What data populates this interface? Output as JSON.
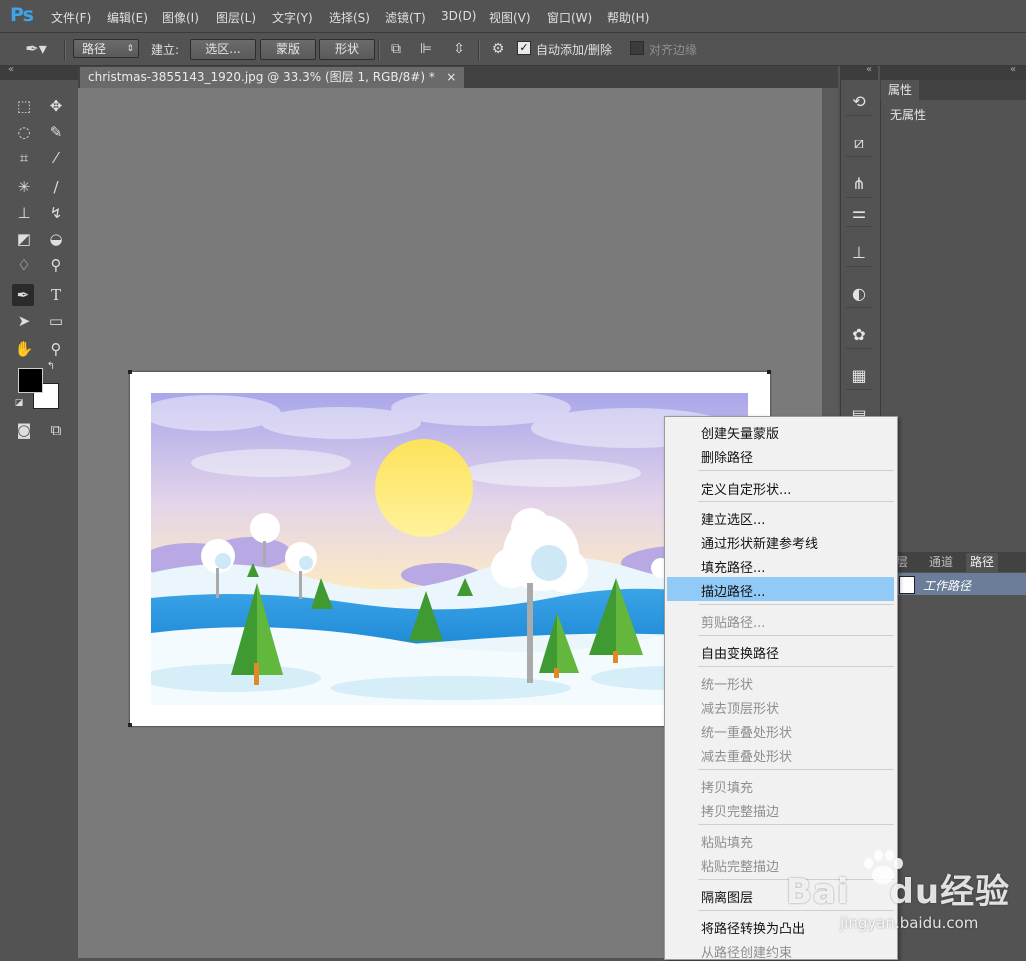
{
  "app": {
    "logo": "Ps"
  },
  "menubar": {
    "items": [
      "文件(F)",
      "编辑(E)",
      "图像(I)",
      "图层(L)",
      "文字(Y)",
      "选择(S)",
      "滤镜(T)",
      "3D(D)",
      "视图(V)",
      "窗口(W)",
      "帮助(H)"
    ]
  },
  "options": {
    "mode_value": "路径",
    "make_label": "建立:",
    "selection_btn": "选区...",
    "mask_btn": "蒙版",
    "shape_btn": "形状",
    "auto_add_label": "自动添加/删除",
    "align_edges_label": "对齐边缘",
    "auto_add_checked": true,
    "align_edges_checked": false
  },
  "document": {
    "tab_title": "christmas-3855143_1920.jpg @ 33.3% (图层 1, RGB/8#) *",
    "close_glyph": "×"
  },
  "properties": {
    "tab": "属性",
    "empty_text": "无属性"
  },
  "paths_panel": {
    "tabs": [
      "图层",
      "通道",
      "路径"
    ],
    "active_tab": "路径",
    "path_name": "工作路径"
  },
  "context_menu": {
    "items": [
      {
        "label": "创建矢量蒙版",
        "enabled": true
      },
      {
        "label": "删除路径",
        "enabled": true
      },
      {
        "label": "定义自定形状...",
        "enabled": true
      },
      {
        "label": "建立选区...",
        "enabled": true
      },
      {
        "label": "通过形状新建参考线",
        "enabled": true
      },
      {
        "label": "填充路径...",
        "enabled": true
      },
      {
        "label": "描边路径...",
        "enabled": true,
        "highlighted": true
      },
      {
        "label": "剪贴路径...",
        "enabled": false
      },
      {
        "label": "自由变换路径",
        "enabled": true
      },
      {
        "label": "统一形状",
        "enabled": false
      },
      {
        "label": "减去顶层形状",
        "enabled": false
      },
      {
        "label": "统一重叠处形状",
        "enabled": false
      },
      {
        "label": "减去重叠处形状",
        "enabled": false
      },
      {
        "label": "拷贝填充",
        "enabled": false
      },
      {
        "label": "拷贝完整描边",
        "enabled": false
      },
      {
        "label": "粘贴填充",
        "enabled": false
      },
      {
        "label": "粘贴完整描边",
        "enabled": false
      },
      {
        "label": "隔离图层",
        "enabled": true
      },
      {
        "label": "将路径转换为凸出",
        "enabled": true
      },
      {
        "label": "从路径创建约束",
        "enabled": false
      }
    ]
  },
  "watermark": {
    "brand": "Bai",
    "brand2": "du",
    "suffix": "经验",
    "url": "jingyan.baidu.com"
  },
  "colors": {
    "accent_blue": "#3fa3e6",
    "menu_highlight": "#91c9f7",
    "selected_row": "#6b7d98"
  }
}
